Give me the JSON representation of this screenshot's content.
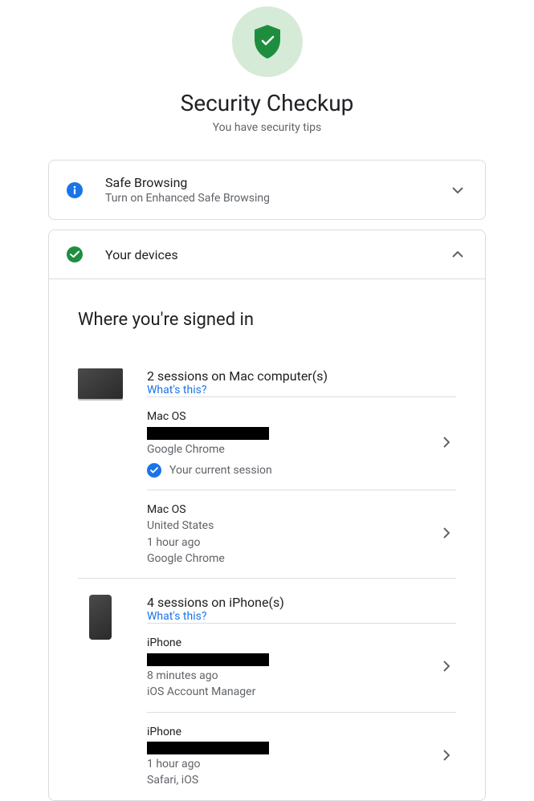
{
  "header": {
    "title": "Security Checkup",
    "subtitle": "You have security tips"
  },
  "safeBrowsing": {
    "title": "Safe Browsing",
    "subtitle": "Turn on Enhanced Safe Browsing"
  },
  "devices": {
    "title": "Your devices",
    "sectionTitle": "Where you're signed in",
    "groups": [
      {
        "heading": "2 sessions on Mac computer(s)",
        "whats_this": "What's this?",
        "sessions": [
          {
            "device": "Mac OS",
            "redacted": true,
            "browser": "Google Chrome",
            "current": "Your current session"
          },
          {
            "device": "Mac OS",
            "location": "United States",
            "time": "1 hour ago",
            "browser": "Google Chrome"
          }
        ]
      },
      {
        "heading": "4 sessions on iPhone(s)",
        "whats_this": "What's this?",
        "sessions": [
          {
            "device": "iPhone",
            "redacted": true,
            "time": "8 minutes ago",
            "browser": "iOS Account Manager"
          },
          {
            "device": "iPhone",
            "redacted": true,
            "time": "1 hour ago",
            "browser": "Safari, iOS"
          }
        ]
      }
    ]
  }
}
